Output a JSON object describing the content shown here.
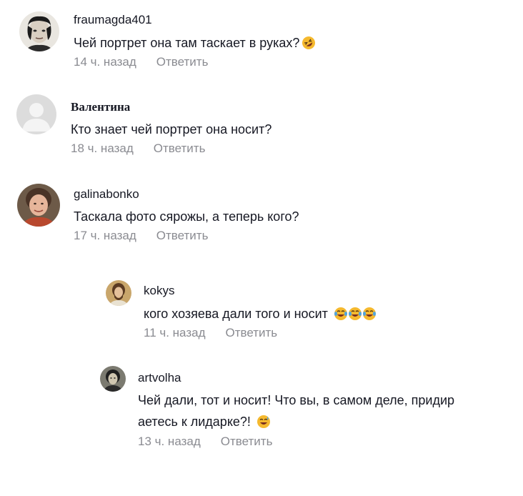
{
  "comments": [
    {
      "username": "fraumagda401",
      "text": "Чей портрет она там таскает в руках?",
      "emoji": "🤣",
      "time": "14 ч. назад",
      "reply": "Ответить"
    },
    {
      "username": "Валентина",
      "text": "Кто знает чей портрет она носит?",
      "time": "18 ч. назад",
      "reply": "Ответить"
    },
    {
      "username": "galinabonko",
      "text": "Таскала фото сярожы, а теперь кого?",
      "time": "17 ч. назад",
      "reply": "Ответить"
    }
  ],
  "replies": [
    {
      "username": "kokys",
      "text": "кого хозяева дали того и носит",
      "emoji": "😂😂😂",
      "time": "11 ч. назад",
      "reply": "Ответить"
    },
    {
      "username": "artvolha",
      "text_line1": "Чей дали, тот и носит! Что вы, в самом деле, придир",
      "text_line2": "аетесь к лидарке?!",
      "emoji": "😅",
      "time": "13 ч. назад",
      "reply": "Ответить"
    }
  ],
  "icons": {
    "laughing_emoji": "rolling-on-floor-laughing",
    "tears_emoji": "face-with-tears-of-joy",
    "sweat_emoji": "grinning-face-with-sweat"
  },
  "colors": {
    "text": "#161823",
    "meta": "#8a8b91",
    "emoji": "#f5b92e"
  }
}
